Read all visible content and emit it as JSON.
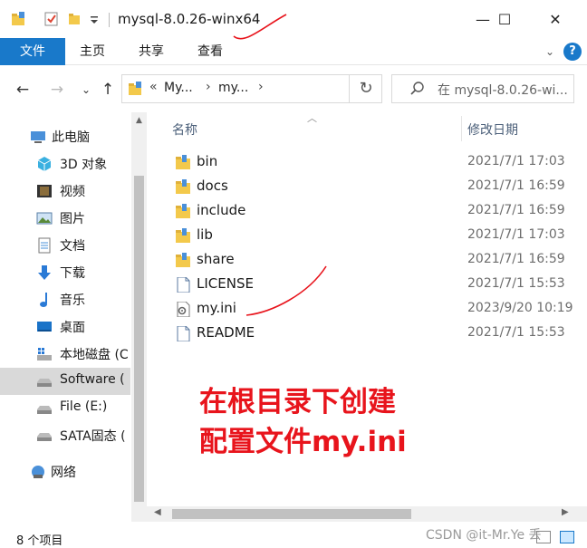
{
  "window": {
    "title": "mysql-8.0.26-winx64",
    "minimize_glyph": "—",
    "maximize_glyph": "☐",
    "close_glyph": "✕"
  },
  "ribbon": {
    "tabs": [
      {
        "label": "文件",
        "active": true
      },
      {
        "label": "主页",
        "active": false
      },
      {
        "label": "共享",
        "active": false
      },
      {
        "label": "查看",
        "active": false
      }
    ],
    "help_label": "?"
  },
  "address": {
    "crumbs": [
      "My...",
      "my..."
    ],
    "overflow": "«"
  },
  "search": {
    "placeholder": "在 mysql-8.0.26-wi..."
  },
  "sidebar": {
    "items": [
      {
        "label": "此电脑",
        "icon": "computer-icon",
        "level": "top"
      },
      {
        "label": "3D 对象",
        "icon": "cube-3d-icon",
        "level": "child"
      },
      {
        "label": "视频",
        "icon": "video-icon",
        "level": "child"
      },
      {
        "label": "图片",
        "icon": "picture-icon",
        "level": "child"
      },
      {
        "label": "文档",
        "icon": "document-icon",
        "level": "child"
      },
      {
        "label": "下载",
        "icon": "download-arrow-icon",
        "level": "child"
      },
      {
        "label": "音乐",
        "icon": "music-note-icon",
        "level": "child"
      },
      {
        "label": "桌面",
        "icon": "desktop-icon",
        "level": "child"
      },
      {
        "label": "本地磁盘 (C",
        "icon": "windows-drive-icon",
        "level": "child"
      },
      {
        "label": "Software (",
        "icon": "drive-icon",
        "level": "child",
        "selected": true
      },
      {
        "label": "File (E:)",
        "icon": "drive-icon",
        "level": "child"
      },
      {
        "label": "SATA固态 (",
        "icon": "drive-icon",
        "level": "child"
      },
      {
        "label": "网络",
        "icon": "network-icon",
        "level": "top"
      }
    ]
  },
  "filelist": {
    "columns": {
      "name": "名称",
      "date": "修改日期"
    },
    "rows": [
      {
        "name": "bin",
        "date": "2021/7/1 17:03",
        "type": "folder"
      },
      {
        "name": "docs",
        "date": "2021/7/1 16:59",
        "type": "folder"
      },
      {
        "name": "include",
        "date": "2021/7/1 16:59",
        "type": "folder"
      },
      {
        "name": "lib",
        "date": "2021/7/1 17:03",
        "type": "folder"
      },
      {
        "name": "share",
        "date": "2021/7/1 16:59",
        "type": "folder"
      },
      {
        "name": "LICENSE",
        "date": "2021/7/1 15:53",
        "type": "file"
      },
      {
        "name": "my.ini",
        "date": "2023/9/20 10:19",
        "type": "ini"
      },
      {
        "name": "README",
        "date": "2021/7/1 15:53",
        "type": "file"
      }
    ]
  },
  "annotation": {
    "line1": "在根目录下创建",
    "line2": "配置文件my.ini"
  },
  "status": {
    "count": "8 个项目",
    "watermark": "CSDN @it-Mr.Ye 丢"
  },
  "colors": {
    "accent": "#1979ca",
    "folder": "#f3c94b",
    "annotation": "#e8141c",
    "selected": "#cce8ff"
  }
}
